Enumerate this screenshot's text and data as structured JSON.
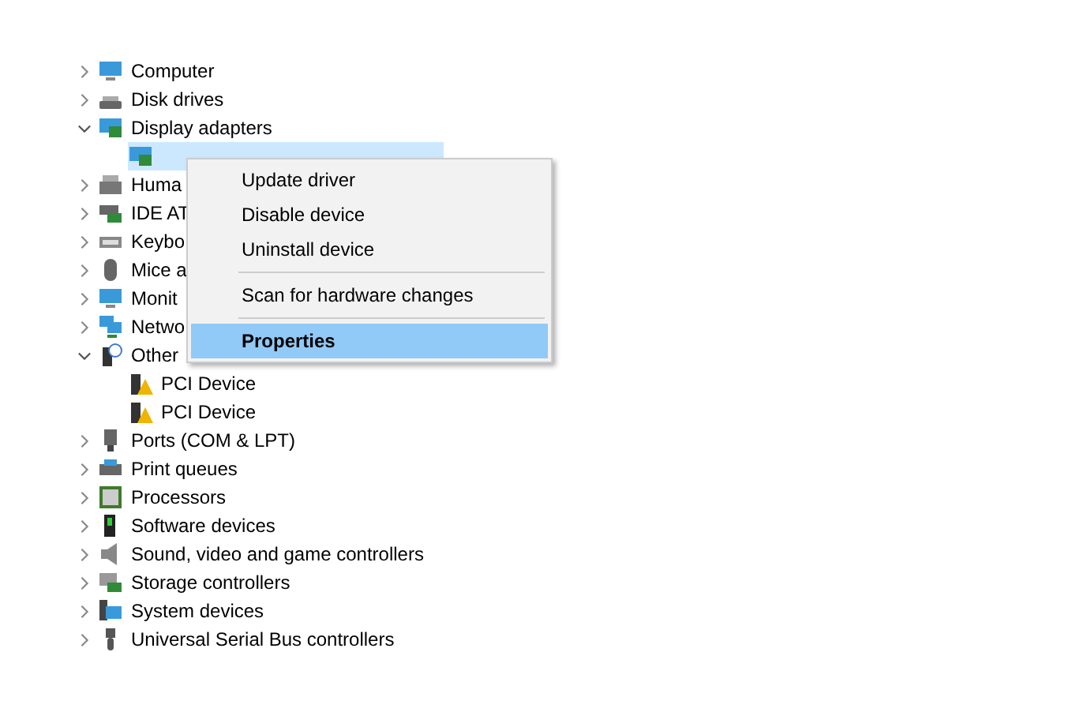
{
  "tree": [
    {
      "label": "Computer",
      "expanded": false,
      "selected": false
    },
    {
      "label": "Disk drives",
      "expanded": false,
      "selected": false
    },
    {
      "label": "Display adapters",
      "expanded": true,
      "selected": false,
      "children": [
        {
          "selected": true
        }
      ]
    },
    {
      "label": "Huma",
      "expanded": false,
      "selected": false
    },
    {
      "label": "IDE AT",
      "expanded": false,
      "selected": false
    },
    {
      "label": "Keybo",
      "expanded": false,
      "selected": false
    },
    {
      "label": "Mice a",
      "expanded": false,
      "selected": false
    },
    {
      "label": "Monit",
      "expanded": false,
      "selected": false
    },
    {
      "label": "Netwo",
      "expanded": false,
      "selected": false
    },
    {
      "label": "Other",
      "expanded": true,
      "selected": false,
      "children": [
        {
          "label": "PCI Device",
          "selected": false
        },
        {
          "label": "PCI Device",
          "selected": false
        }
      ]
    },
    {
      "label": "Ports (COM & LPT)",
      "expanded": false,
      "selected": false
    },
    {
      "label": "Print queues",
      "expanded": false,
      "selected": false
    },
    {
      "label": "Processors",
      "expanded": false,
      "selected": false
    },
    {
      "label": "Software devices",
      "expanded": false,
      "selected": false
    },
    {
      "label": "Sound, video and game controllers",
      "expanded": false,
      "selected": false
    },
    {
      "label": "Storage controllers",
      "expanded": false,
      "selected": false
    },
    {
      "label": "System devices",
      "expanded": false,
      "selected": false
    },
    {
      "label": "Universal Serial Bus controllers",
      "expanded": false,
      "selected": false
    }
  ],
  "context_menu": [
    {
      "kind": "item",
      "label": "Update driver",
      "selected": false,
      "default": false
    },
    {
      "kind": "item",
      "label": "Disable device",
      "selected": false,
      "default": false
    },
    {
      "kind": "item",
      "label": "Uninstall device",
      "selected": false,
      "default": false
    },
    {
      "kind": "separator"
    },
    {
      "kind": "item",
      "label": "Scan for hardware changes",
      "selected": false,
      "default": false
    },
    {
      "kind": "separator"
    },
    {
      "kind": "item",
      "label": "Properties",
      "selected": true,
      "default": true
    }
  ]
}
